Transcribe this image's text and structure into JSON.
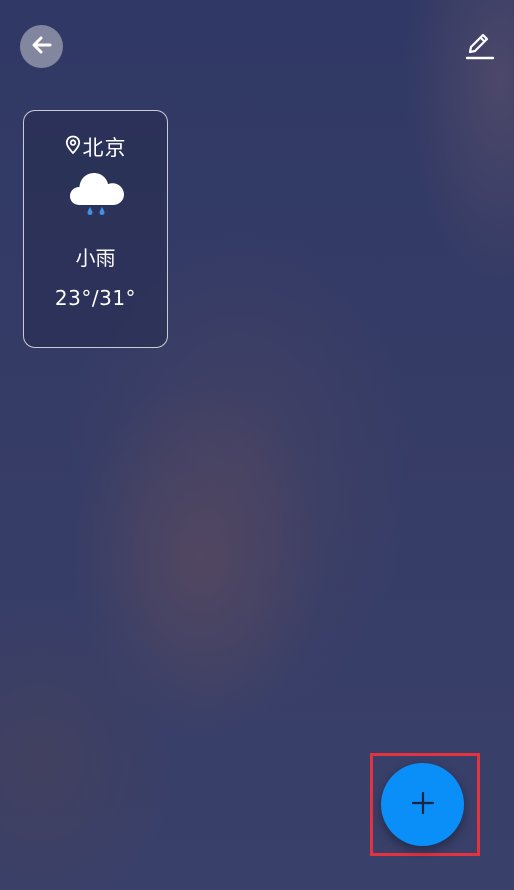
{
  "header": {
    "back_icon": "arrow-left-icon",
    "edit_icon": "pencil-edit-icon"
  },
  "cities": [
    {
      "location_icon": "map-pin-icon",
      "name": "北京",
      "weather_icon": "cloud-rain-icon",
      "condition": "小雨",
      "temperature_range": "23°/31°"
    }
  ],
  "fab": {
    "icon": "plus-icon"
  },
  "colors": {
    "accent": "#0a8ef8",
    "highlight": "#e5323f",
    "rain_drop": "#3d8fe8"
  }
}
